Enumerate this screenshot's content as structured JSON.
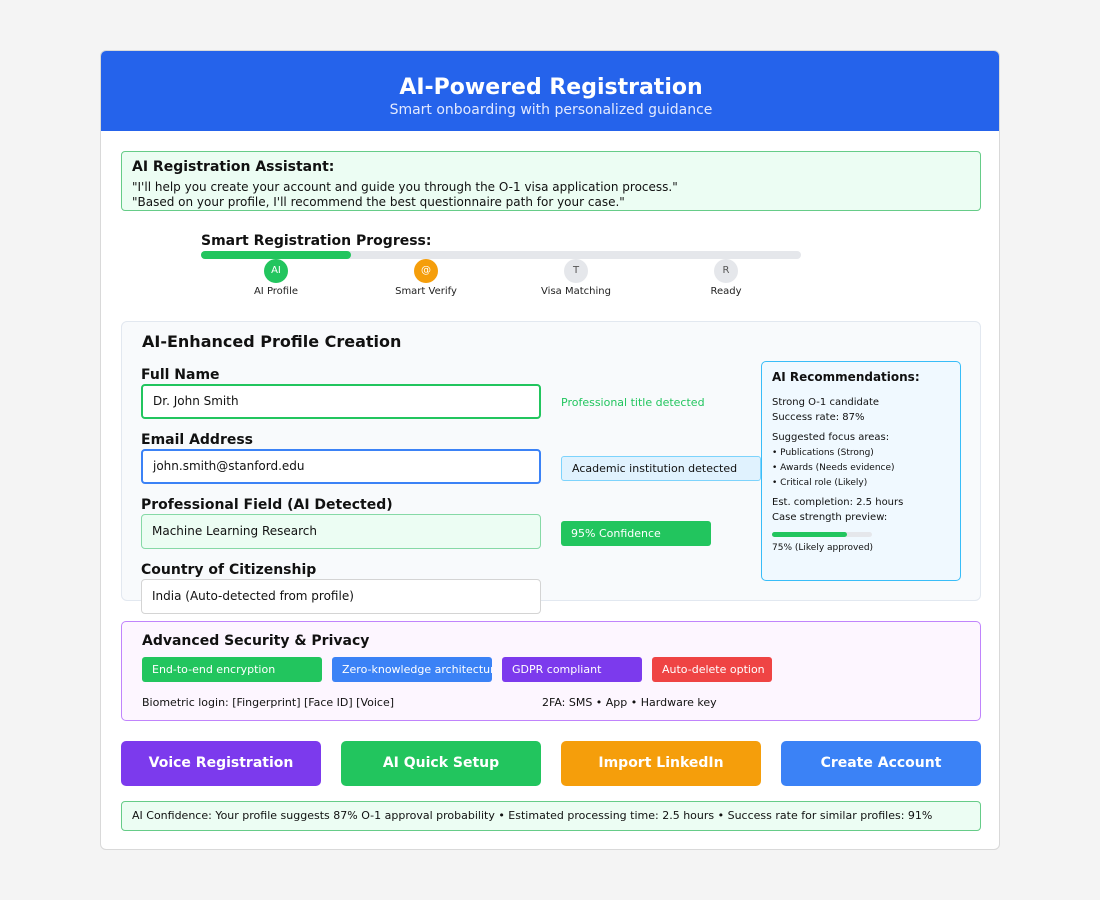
{
  "header": {
    "title": "AI-Powered Registration",
    "subtitle": "Smart onboarding with personalized guidance"
  },
  "assistant": {
    "title": "AI Registration Assistant:",
    "lines": [
      "\"I'll help you create your account and guide you through the O-1 visa application process.\"",
      "\"Based on your profile, I'll recommend the best questionnaire path for your case.\""
    ]
  },
  "progress": {
    "title": "Smart Registration Progress:",
    "fraction": 0.25,
    "steps": [
      {
        "icon": "AI",
        "label": "AI Profile",
        "state": "done"
      },
      {
        "icon": "@",
        "label": "Smart Verify",
        "state": "active"
      },
      {
        "icon": "T",
        "label": "Visa Matching",
        "state": "pending"
      },
      {
        "icon": "R",
        "label": "Ready",
        "state": "pending"
      }
    ]
  },
  "profile": {
    "title": "AI-Enhanced Profile Creation",
    "fields": {
      "full_name": {
        "label": "Full Name",
        "value": "Dr. John Smith"
      },
      "email": {
        "label": "Email Address",
        "value": "john.smith@stanford.edu"
      },
      "field": {
        "label": "Professional Field (AI Detected)",
        "value": "Machine Learning Research"
      },
      "country": {
        "label": "Country of Citizenship",
        "value": "India (Auto-detected from profile)"
      }
    },
    "hints": {
      "name": "Professional title detected",
      "email": "Academic institution detected",
      "confidence": "95% Confidence"
    }
  },
  "recommendations": {
    "title": "AI Recommendations:",
    "candidate": "Strong O-1 candidate",
    "success_rate": "Success rate: 87%",
    "focus_title": "Suggested focus areas:",
    "focus_items": [
      "• Publications (Strong)",
      "• Awards (Needs evidence)",
      "• Critical role (Likely)"
    ],
    "completion": "Est. completion: 2.5 hours",
    "strength_label": "Case strength preview:",
    "strength_value": 0.75,
    "strength_text": "75% (Likely approved)"
  },
  "security": {
    "title": "Advanced Security & Privacy",
    "chips": [
      {
        "label": "End-to-end encryption",
        "color": "#22c55e"
      },
      {
        "label": "Zero-knowledge architecture",
        "color": "#3b82f6"
      },
      {
        "label": "GDPR compliant",
        "color": "#7c3aed"
      },
      {
        "label": "Auto-delete option",
        "color": "#ef4444"
      }
    ],
    "biometric": "Biometric login: [Fingerprint] [Face ID] [Voice]",
    "twofa": "2FA: SMS • App • Hardware key"
  },
  "actions": {
    "voice": "Voice Registration",
    "quick": "AI Quick Setup",
    "linkedin": "Import LinkedIn",
    "create": "Create Account"
  },
  "footer": {
    "text": "AI Confidence: Your profile suggests 87% O-1 approval probability • Estimated processing time: 2.5 hours • Success rate for similar profiles: 91%"
  },
  "colors": {
    "primary": "#2563eb",
    "success": "#22c55e",
    "warning": "#f59e0b",
    "purple": "#7c3aed",
    "danger": "#ef4444",
    "blue": "#3b82f6"
  }
}
